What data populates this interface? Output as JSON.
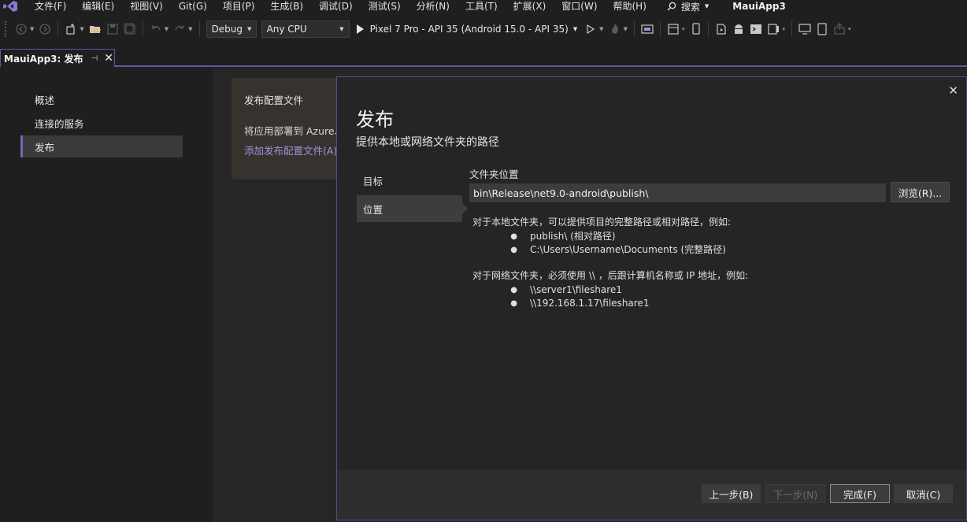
{
  "menubar": {
    "items": [
      "文件(F)",
      "编辑(E)",
      "视图(V)",
      "Git(G)",
      "项目(P)",
      "生成(B)",
      "调试(D)",
      "测试(S)",
      "分析(N)",
      "工具(T)",
      "扩展(X)",
      "窗口(W)",
      "帮助(H)"
    ],
    "search_label": "搜索",
    "app_title": "MauiApp3"
  },
  "toolbar": {
    "configuration": "Debug",
    "platform": "Any CPU",
    "run_target": "Pixel 7 Pro - API 35 (Android 15.0 - API 35)"
  },
  "document_tab": {
    "title": "MauiApp3: 发布"
  },
  "left_nav": {
    "items": [
      {
        "label": "概述",
        "selected": false
      },
      {
        "label": "连接的服务",
        "selected": false
      },
      {
        "label": "发布",
        "selected": true
      }
    ]
  },
  "profile_card": {
    "title": "发布配置文件",
    "description": "将应用部署到 Azure、",
    "add_link": "添加发布配置文件(A)"
  },
  "dialog": {
    "title": "发布",
    "subtitle": "提供本地或网络文件夹的路径",
    "steps": [
      {
        "label": "目标",
        "active": false
      },
      {
        "label": "位置",
        "active": true
      }
    ],
    "folder_label": "文件夹位置",
    "folder_value": "bin\\Release\\net9.0-android\\publish\\",
    "browse_label": "浏览(R)...",
    "help_local_intro": "对于本地文件夹，可以提供项目的完整路径或相对路径，例如:",
    "help_local_examples": [
      "publish\\ (相对路径)",
      "C:\\Users\\Username\\Documents (完整路径)"
    ],
    "help_network_intro": "对于网络文件夹，必须使用 \\\\ ，后跟计算机名称或 IP 地址，例如:",
    "help_network_examples": [
      "\\\\server1\\fileshare1",
      "\\\\192.168.1.17\\fileshare1"
    ],
    "buttons": {
      "back": "上一步(B)",
      "next": "下一步(N)",
      "finish": "完成(F)",
      "cancel": "取消(C)"
    }
  },
  "colors": {
    "accent": "#68539c",
    "link": "#a48fde",
    "background": "#1f1f1f"
  }
}
